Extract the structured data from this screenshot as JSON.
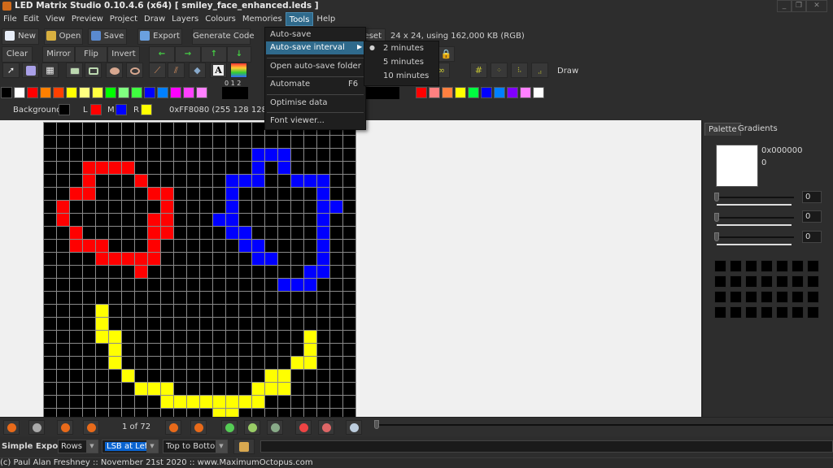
{
  "window": {
    "title": "LED Matrix Studio 0.10.4.6 (x64)  [ smiley_face_enhanced.leds ]",
    "minimize": "_",
    "restore": "❐",
    "close": "✕"
  },
  "menubar": [
    "File",
    "Edit",
    "View",
    "Preview",
    "Project",
    "Draw",
    "Layers",
    "Colours",
    "Memories",
    "Tools",
    "Help"
  ],
  "toolbar": {
    "new": "New",
    "open": "Open",
    "save": "Save",
    "export": "Export",
    "generate_code": "Generate Code",
    "preset": "reset",
    "info": "24 x 24, using 162,000 KB (RGB)"
  },
  "toolbar2": {
    "clear": "Clear",
    "mirror": "Mirror",
    "flip": "Flip",
    "invert": "Invert",
    "arrows": [
      "←",
      "→",
      "↑",
      "↓"
    ]
  },
  "toolbar3": {
    "tools": [
      "pointer-icon",
      "brick-icon",
      "selection-icon",
      "filled-rect-icon",
      "rect-icon",
      "filled-ellipse-icon",
      "ellipse-icon",
      "brush-icon",
      "multi-brush-icon",
      "fill-icon",
      "text-icon",
      "gradient-brush-icon"
    ],
    "draw_label": "Draw",
    "layer_numbers": "0  1  2"
  },
  "palette_left": [
    "#000000",
    "#ffffff",
    "#ff0000",
    "#ff8000",
    "#ff4000",
    "#ffff00",
    "#ffff80",
    "#ffff40",
    "#00ff00",
    "#80ff80",
    "#40ff40",
    "#0000ff",
    "#0080ff",
    "#ff00ff",
    "#ff40ff",
    "#ff80ff"
  ],
  "palette_right": [
    "#ff0000",
    "#ff8080",
    "#ff8040",
    "#ffff00",
    "#00ff40",
    "#0000ff",
    "#0080ff",
    "#8000ff",
    "#ff80ff",
    "#ffffff"
  ],
  "colours": {
    "background_label": "Background",
    "background": "#000000",
    "l_label": "L",
    "l": "#ff0000",
    "m_label": "M",
    "m": "#0000ff",
    "r_label": "R",
    "r": "#ffff00",
    "hex": "0xFF8080 (255 128 128)"
  },
  "tools_menu": {
    "items": [
      "Auto-save",
      "Auto-save interval",
      "Open auto-save folder",
      "Automate",
      "Optimise data",
      "Font viewer..."
    ],
    "automate_shortcut": "F6",
    "interval_options": [
      "2 minutes",
      "5 minutes",
      "10 minutes"
    ],
    "selected_interval": "2 minutes"
  },
  "matrix": {
    "colors": {
      "R": "#ff0000",
      "B": "#0000ff",
      "Y": "#ffff00",
      ".": "#000000"
    },
    "rows": [
      "........................",
      "........................",
      "................BBB.....",
      "...RRRR.........B.B.....",
      "...R...R......BBB..BBB..",
      "..RR....RR....B......B..",
      ".R.......R....B......BB.",
      ".R......RR...BB......B..",
      "..R.....RR....BB.....B..",
      "..RRR...R......BB....B..",
      "....RRRRR.......BB...B..",
      ".......R............BB..",
      "..................BBB...",
      "........................",
      "....Y...................",
      "....Y...................",
      "....YY..............Y...",
      ".....Y..............Y...",
      ".....Y.............YY...",
      "......Y..........YY.....",
      ".......YYY......YYY.....",
      ".........YYYYYYYY.......",
      ".............YY.........",
      "........................"
    ]
  },
  "right_panel": {
    "tabs": [
      "Palette",
      "Gradients"
    ],
    "selected_colour": "#ffffff",
    "hex": "0x000000",
    "value": "0",
    "sliders": [
      0,
      0,
      0
    ],
    "slider_values": [
      "0",
      "0",
      "0"
    ]
  },
  "animation": {
    "frame": "1 of 72"
  },
  "export": {
    "label": "Simple Export",
    "mode": "Rows",
    "lsb": "LSB at Left",
    "direction": "Top to Bottom"
  },
  "status": "(c) Paul Alan Freshney :: November 21st 2020 :: www.MaximumOctopus.com"
}
